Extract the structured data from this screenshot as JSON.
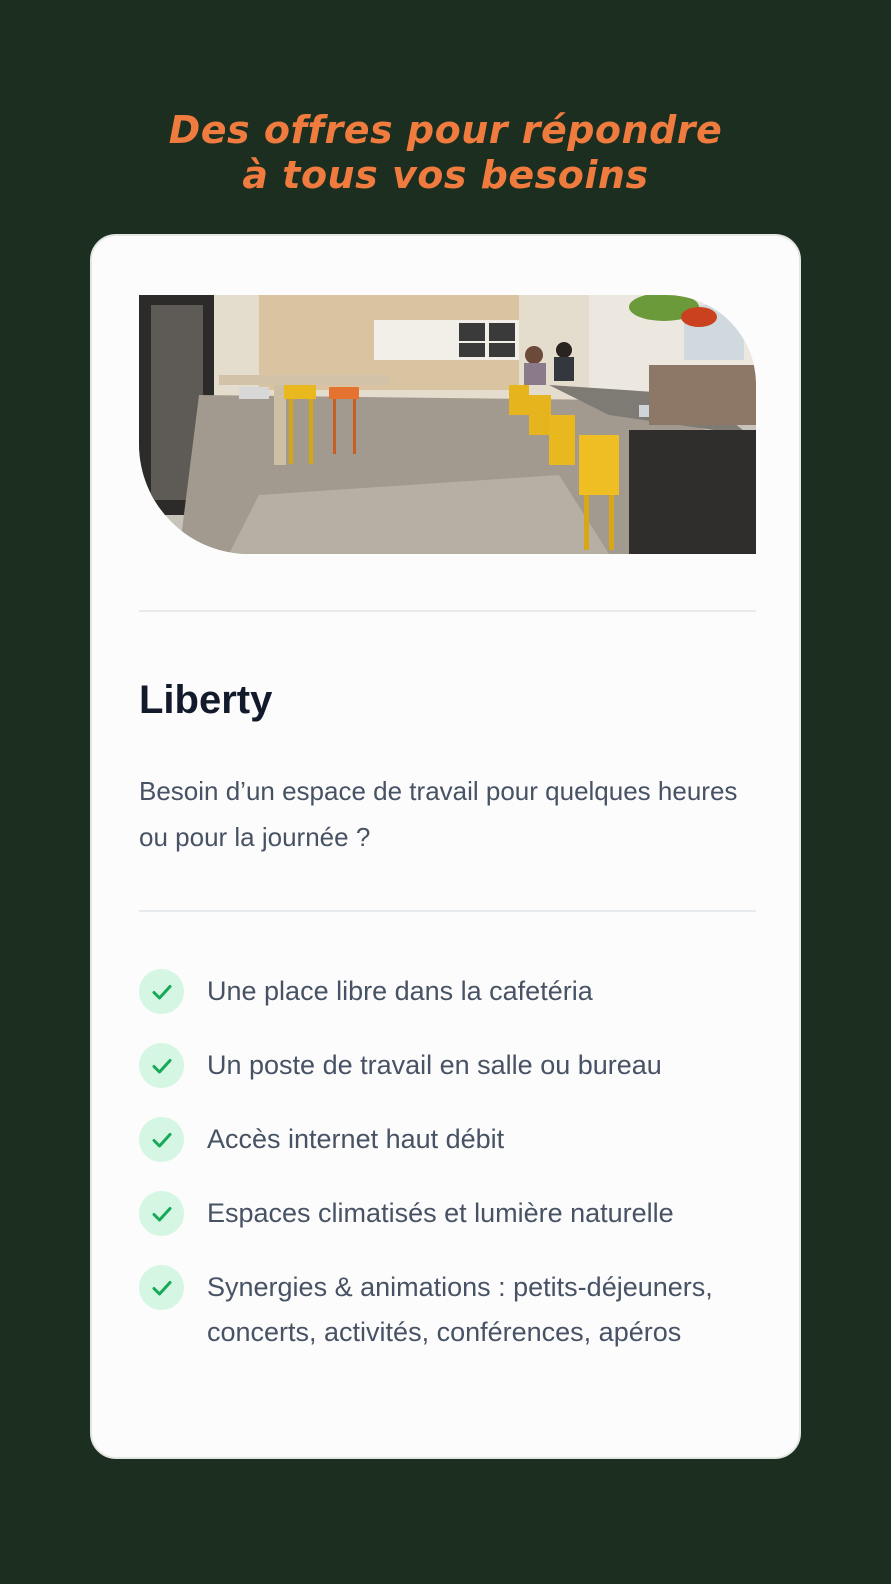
{
  "headline": {
    "line1": "Des offres pour répondre",
    "line2": "à tous vos besoins"
  },
  "card": {
    "title": "Liberty",
    "description": "Besoin d’un espace de travail pour quelques heures ou pour la journée ?",
    "features": [
      "Une place libre dans la cafetéria",
      "Un poste de travail en salle ou bureau",
      "Accès internet haut débit",
      "Espaces climatisés et lumière naturelle",
      "Synergies & animations : petits-déjeuners, concerts, activités, conférences, apéros"
    ]
  },
  "icons": {
    "feature_icon": "check-icon"
  },
  "colors": {
    "background": "#1b2e1f",
    "headline": "#f07b3f",
    "card": "#fcfcfc",
    "check_bg": "#d5f6e2",
    "check_mark": "#17a858",
    "title": "#121a2c",
    "body_text": "#475264"
  }
}
